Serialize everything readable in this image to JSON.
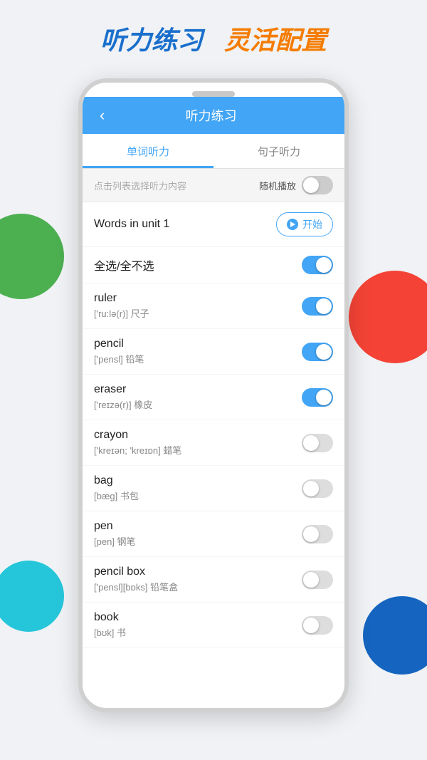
{
  "page": {
    "header_blue": "听力练习",
    "header_orange": "灵活配置"
  },
  "topbar": {
    "back_icon": "‹",
    "title": "听力练习"
  },
  "tabs": [
    {
      "id": "word",
      "label": "单词听力",
      "active": true
    },
    {
      "id": "sentence",
      "label": "句子听力",
      "active": false
    }
  ],
  "toolbar": {
    "hint": "点击列表选择听力内容",
    "random_label": "随机播放",
    "toggle_state": "off"
  },
  "unit": {
    "label": "Words in unit 1",
    "start_btn_label": "开始"
  },
  "words": [
    {
      "en": "全选/全不选",
      "phonetic": "",
      "cn": "",
      "on": true
    },
    {
      "en": "ruler",
      "phonetic": "['ru:lə(r)]",
      "cn": "尺子",
      "on": true
    },
    {
      "en": "pencil",
      "phonetic": "['pensl]",
      "cn": "铅笔",
      "on": true
    },
    {
      "en": "eraser",
      "phonetic": "['reɪzə(r)]",
      "cn": "橡皮",
      "on": true
    },
    {
      "en": "crayon",
      "phonetic": "['kreɪən; 'kreɪɒn]",
      "cn": "蜡笔",
      "on": false
    },
    {
      "en": "bag",
      "phonetic": "[bæg]",
      "cn": "书包",
      "on": false
    },
    {
      "en": "pen",
      "phonetic": "[pen]",
      "cn": "钢笔",
      "on": false
    },
    {
      "en": "pencil box",
      "phonetic": "['pensl][bɒks]",
      "cn": "铅笔盒",
      "on": false
    },
    {
      "en": "book",
      "phonetic": "[bʊk]",
      "cn": "书",
      "on": false
    }
  ]
}
